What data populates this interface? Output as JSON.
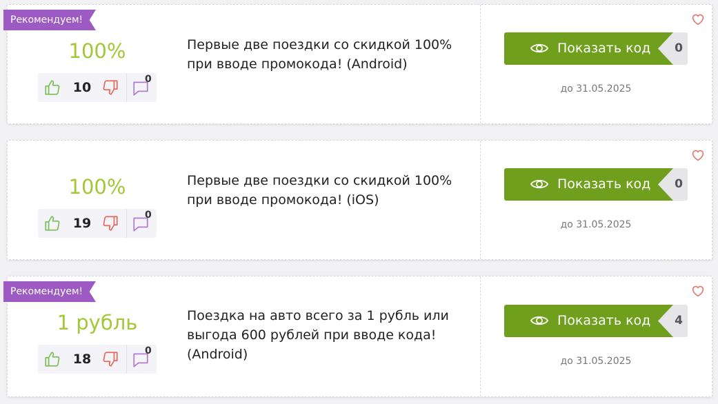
{
  "colors": {
    "accent_green": "#a4c639",
    "button_green": "#6f9f1c",
    "badge_purple": "#9c5ac2"
  },
  "icons": {
    "like": "thumb-up-icon",
    "dislike": "thumb-down-icon",
    "comment": "comment-icon",
    "show": "eye-icon",
    "favorite": "heart-icon"
  },
  "offers": [
    {
      "badge": "Рекомендуем!",
      "discount": "100%",
      "likes": "10",
      "comments": "0",
      "description": "Первые две поездки со скидкой 100% при вводе промокода! (Android)",
      "button_label": "Показать код",
      "code_peek": "0",
      "expiry": "до 31.05.2025"
    },
    {
      "badge": "",
      "discount": "100%",
      "likes": "19",
      "comments": "0",
      "description": "Первые две поездки со скидкой 100% при вводе промокода! (iOS)",
      "button_label": "Показать код",
      "code_peek": "0",
      "expiry": "до 31.05.2025"
    },
    {
      "badge": "Рекомендуем!",
      "discount": "1 рубль",
      "likes": "18",
      "comments": "0",
      "description": "Поездка на авто всего за 1 рубль или выгода 600 рублей при вводе кода! (Android)",
      "button_label": "Показать код",
      "code_peek": "4",
      "expiry": "до 31.05.2025"
    }
  ]
}
